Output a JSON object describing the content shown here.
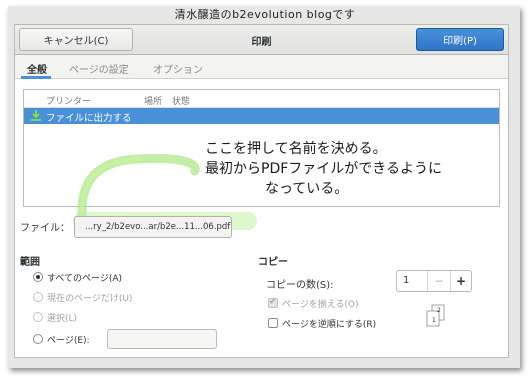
{
  "background_title": "清水醸造のb2evolution blogです",
  "dialog": {
    "title": "印刷",
    "cancel_label": "キャンセル(C)",
    "print_label": "印刷(P)"
  },
  "tabs": [
    {
      "label": "全般",
      "active": true
    },
    {
      "label": "ページの設定",
      "active": false
    },
    {
      "label": "オプション",
      "active": false
    }
  ],
  "printer_list": {
    "columns": [
      "プリンター",
      "場所",
      "状態"
    ],
    "rows": [
      {
        "name": "ファイルに出力する",
        "icon": "download-icon",
        "selected": true
      }
    ]
  },
  "annotation": {
    "lines": [
      "ここを押して名前を決める。",
      "最初からPDFファイルができるように",
      "なっている。"
    ]
  },
  "file": {
    "label": "ファイル：",
    "value": "...ry_2/b2evo...ar/b2e...11...06.pdf"
  },
  "range": {
    "title": "範囲",
    "options": [
      {
        "label": "すべてのページ(A)",
        "selected": true,
        "enabled": true
      },
      {
        "label": "現在のページだけ(U)",
        "selected": false,
        "enabled": false
      },
      {
        "label": "選択(L)",
        "selected": false,
        "enabled": false
      },
      {
        "label": "ページ(E):",
        "selected": false,
        "enabled": true
      }
    ],
    "pages_value": ""
  },
  "copies": {
    "title": "コピー",
    "count_label": "コピーの数(S):",
    "count_value": "1",
    "minus": "−",
    "plus": "+",
    "collate_label": "ページを揃える(O)",
    "collate_checked": true,
    "collate_enabled": false,
    "reverse_label": "ページを逆順にする(R)",
    "reverse_checked": false,
    "collate_icon_labels": [
      "1",
      "2"
    ]
  },
  "colors": {
    "accent": "#4a90d9",
    "annotation_green": "#9be36a"
  }
}
